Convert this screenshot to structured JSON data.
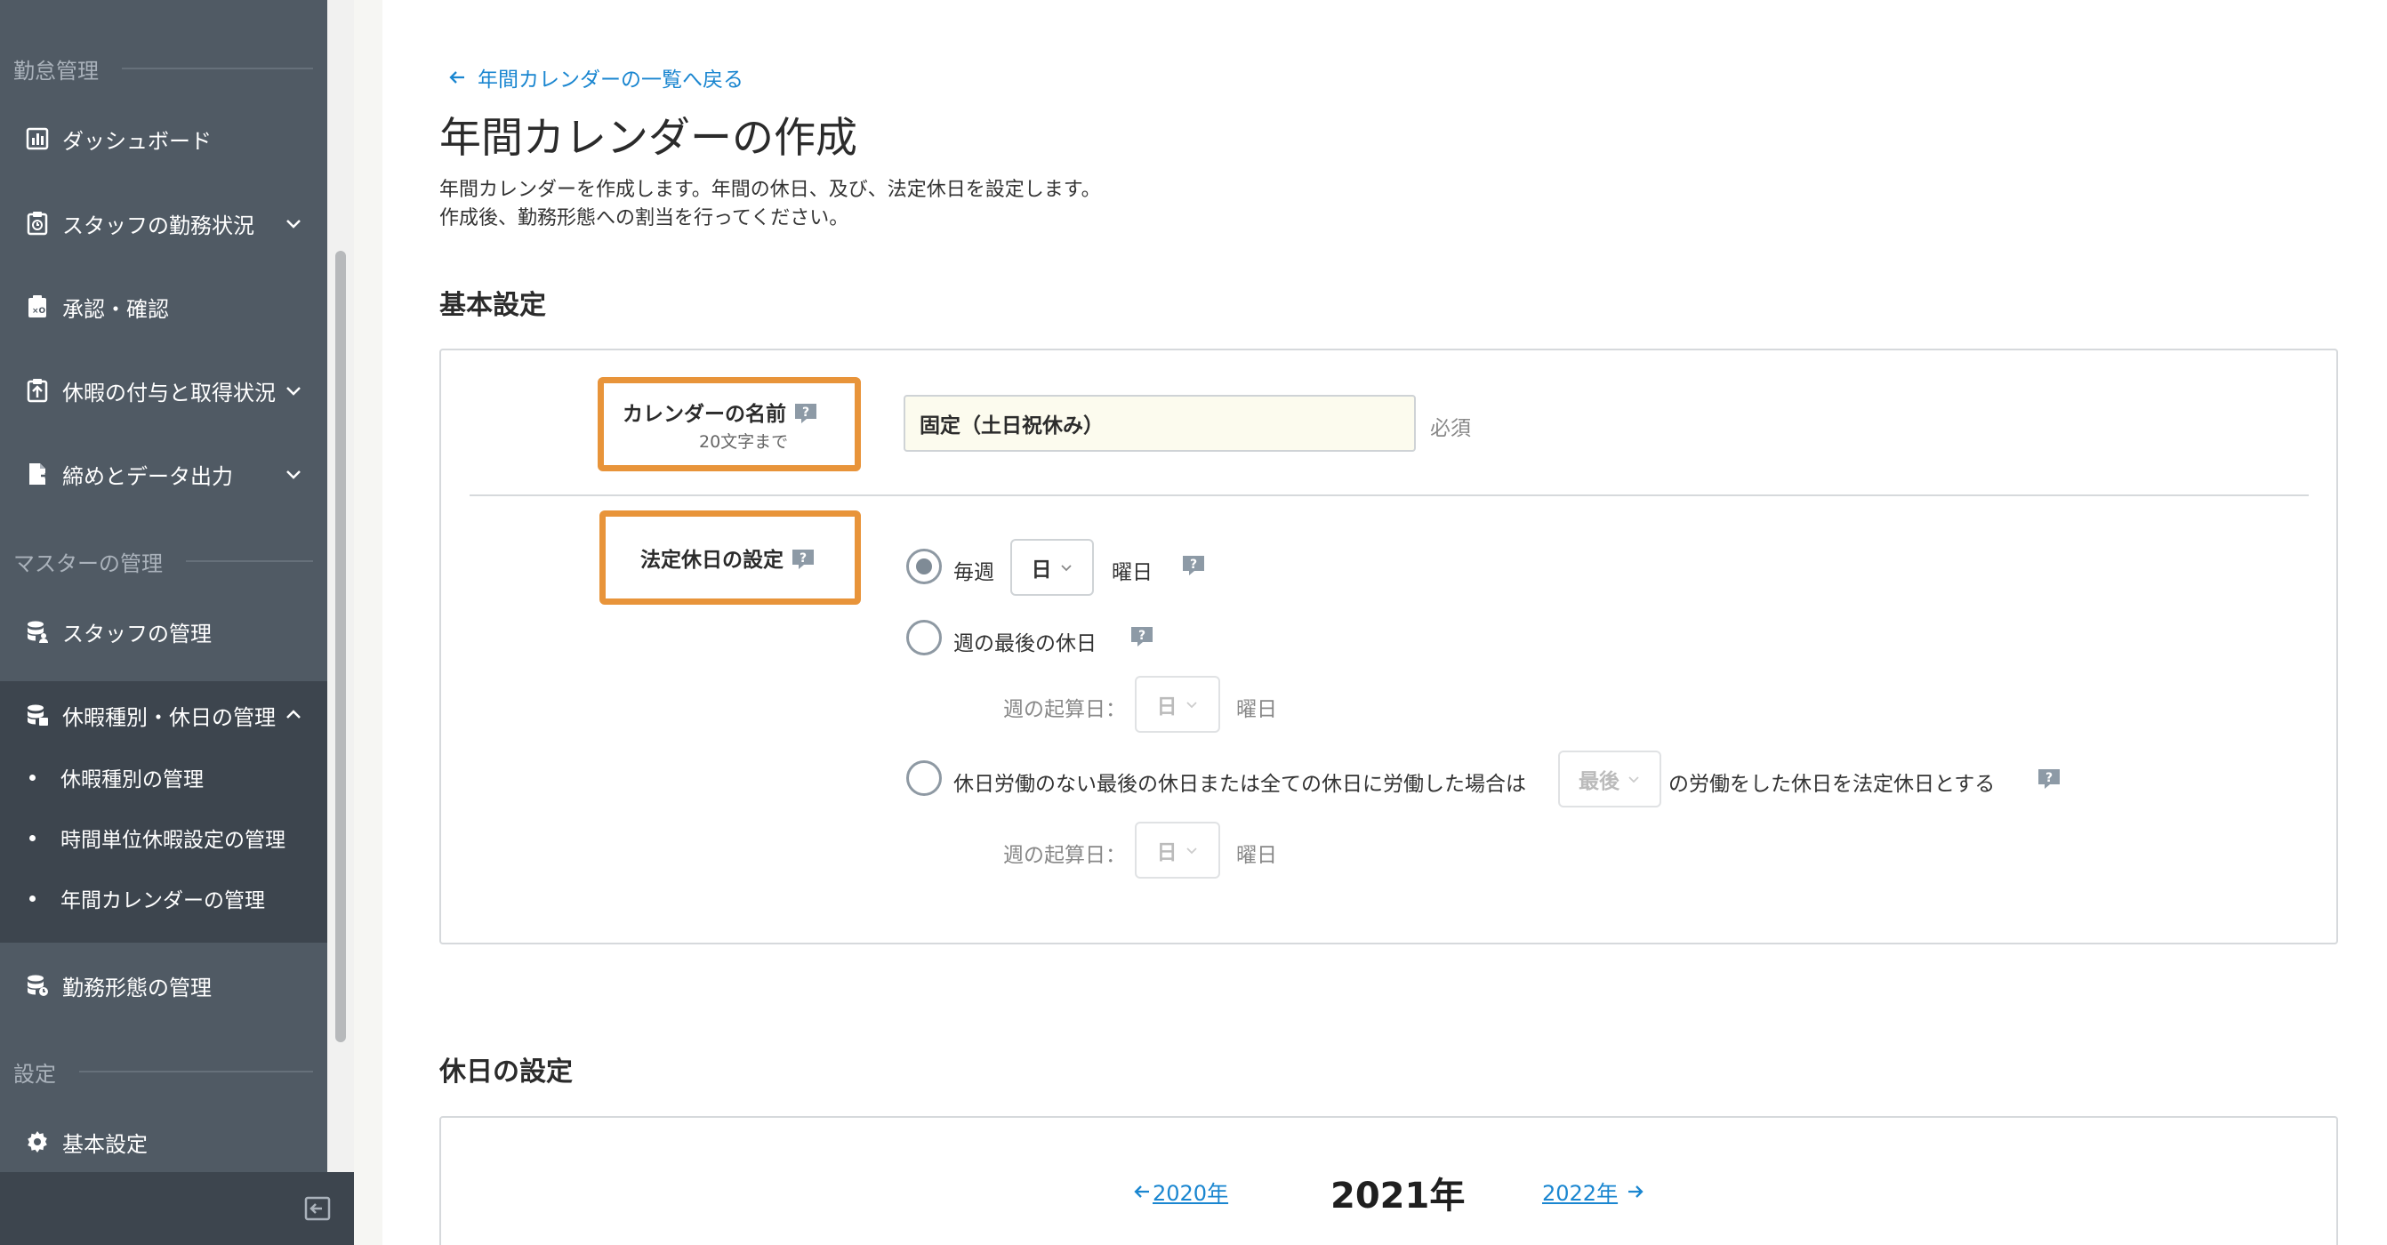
{
  "sidebar": {
    "sections": {
      "attendance": "勤怠管理",
      "master": "マスターの管理",
      "settings": "設定"
    },
    "items": {
      "dashboard": "ダッシュボード",
      "staff_status": "スタッフの勤務状況",
      "approval": "承認・確認",
      "leave_status": "休暇の付与と取得状況",
      "closing_export": "締めとデータ出力",
      "staff_mgmt": "スタッフの管理",
      "leave_types_mgmt": "休暇種別・休日の管理",
      "work_pattern_mgmt": "勤務形態の管理",
      "basic_settings": "基本設定"
    },
    "subitems": {
      "leave_types": "休暇種別の管理",
      "hourly_leave": "時間単位休暇設定の管理",
      "annual_calendar": "年間カレンダーの管理"
    }
  },
  "main": {
    "back_link": "年間カレンダーの一覧へ戻る",
    "title": "年間カレンダーの作成",
    "desc_line1": "年間カレンダーを作成します。年間の休日、及び、法定休日を設定します。",
    "desc_line2": "作成後、勤務形態への割当を行ってください。",
    "basic_section": "基本設定",
    "calendar_name": {
      "label": "カレンダーの名前",
      "note": "20文字まで",
      "value": "固定（土日祝休み）",
      "required": "必須"
    },
    "legal_holiday": {
      "label": "法定休日の設定",
      "opt1_prefix": "毎週",
      "opt1_select": "日",
      "opt1_suffix": "曜日",
      "opt2_text": "週の最後の休日",
      "week_start_label": "週の起算日：",
      "week_start_value": "日",
      "week_start_suffix": "曜日",
      "opt3_prefix": "休日労働のない最後の休日または全ての休日に労働した場合は",
      "opt3_select": "最後",
      "opt3_suffix": "の労働をした休日を法定休日とする"
    },
    "holiday_section": "休日の設定",
    "year_nav": {
      "prev": "2020年",
      "current": "2021年",
      "next": "2022年"
    }
  },
  "colors": {
    "sidebar_bg": "#505a64",
    "sidebar_active_bg": "#3d454e",
    "accent_link": "#1a86d0",
    "highlight_border": "#e8943a",
    "input_bg": "#fcfbee"
  }
}
